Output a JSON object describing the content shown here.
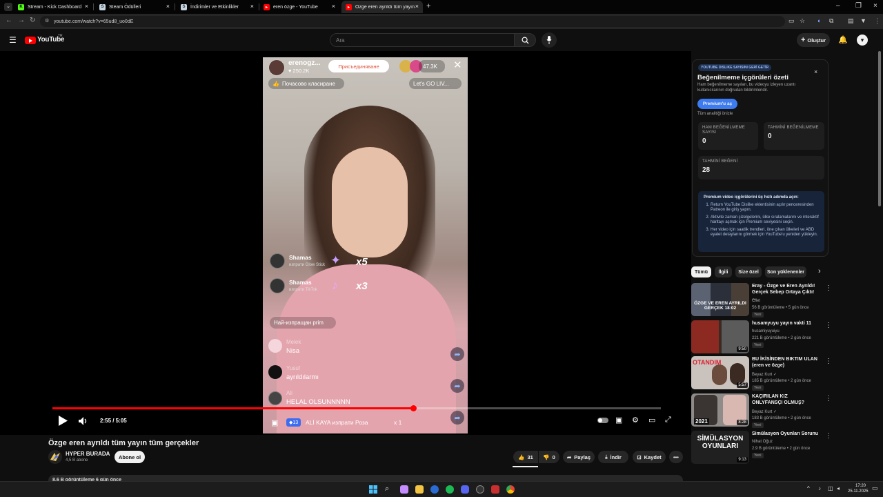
{
  "browser": {
    "tabs": [
      {
        "label": "Stream - Kick Dashboard",
        "icon": "kick-icon",
        "color": "#53fc18"
      },
      {
        "label": "Steam Ödülleri",
        "icon": "steam-icon",
        "color": "#1b2838"
      },
      {
        "label": "İndirimler ve Etkinlikler",
        "icon": "steam-icon",
        "color": "#1b2838"
      },
      {
        "label": "eren özge - YouTube",
        "icon": "youtube-icon",
        "color": "#ff0000"
      },
      {
        "label": "Özge eren ayrıldı tüm yayın tüm",
        "icon": "youtube-icon",
        "color": "#ff0000"
      }
    ],
    "url": "youtube.com/watch?v=65ud8_uo0dE"
  },
  "youtube": {
    "logo_text": "YouTube",
    "region": "TR",
    "search_placeholder": "Ara",
    "create_label": "Oluştur"
  },
  "video_overlay": {
    "streamer": "erenogz...",
    "likes": "250.2K",
    "join_label": "Присъединяване",
    "viewers": "47.3K",
    "hourly_rank": "Почасово класиране",
    "lets_go": "Let's GO LIV...",
    "gifts": [
      {
        "name": "Shamas",
        "desc": "изпрати Glow Stick",
        "count": "x5"
      },
      {
        "name": "Shamas",
        "desc": "изпрати TikTok",
        "count": "x3"
      }
    ],
    "top_sender": "Най-изпращан prim",
    "comments": [
      {
        "user": "Melek",
        "text": "Nisa"
      },
      {
        "user": "Yusuf",
        "text": "ayrıldılarmı"
      },
      {
        "user": "Ali",
        "text": "HELAL OLSUNNNNN"
      }
    ],
    "bottom_gift_count": "13",
    "bottom_gift_text": "ALİ KAYA изпрати Роза",
    "bottom_gift_mult": "x 1"
  },
  "player": {
    "time": "2:55 / 5:05",
    "progress": 0.594
  },
  "video": {
    "title": "Özge eren ayrıldı tüm yayın tüm gerçekler",
    "channel": "HYPER BURADA",
    "subscribers": "4,5 B abone",
    "subscribe_label": "Abone ol",
    "likes": "31",
    "dislikes": "0",
    "share_label": "Paylaş",
    "download_label": "İndir",
    "save_label": "Kaydet",
    "description_stats": "8,6 B görüntüleme  6 gün önce"
  },
  "rdl_panel": {
    "badge": "YOUTUBE DISLIKE SAYISINI GERİ GETİR",
    "title": "Beğenilmeme içgörüleri özeti",
    "description": "Ham beğenilmeme sayıları, bu videoyu izleyen uzantı kullanıcılarının doğrudan bildirimleridir.",
    "premium_button": "Premium'u aç",
    "preview_link": "Tüm analitiği önizle",
    "raw_dislikes_label": "HAM BEĞENİLMEME SAYISI",
    "raw_dislikes": "0",
    "est_dislikes_label": "TAHMİNİ BEĞENİLMEME",
    "est_dislikes": "0",
    "est_likes_label": "TAHMİNİ BEĞENİ",
    "est_likes": "28",
    "steps_title": "Premium video içgörülerini üç hızlı adımda açın:",
    "steps": [
      "Return YouTube Dislike eklentisinin açılır penceresinden Patreon ile giriş yapın.",
      "Aktivite zaman çizelgelerini, ülke sıralamalarını ve interaktif haritayı açmak için Premium seviyesini seçin.",
      "Her video için saatlik trendleri, öne çıkan ülkeleri ve ABD eyalet detaylarını görmek için YouTube'u yeniden yükleyin."
    ]
  },
  "filter_chips": [
    "Tümü",
    "İlgili",
    "Size özel",
    "Son yüklenenler"
  ],
  "recommendations": [
    {
      "title": "Eray - Özge ve Eren Ayrıldı! Gerçek Sebep Ortaya Çıktı! ...",
      "channel": "Cilet",
      "meta": "56 B görüntüleme • 5 gün önce",
      "badge": "Yeni",
      "duration": "",
      "thumb_text": "ÖZGE VE EREN AYRILDI GERÇEK 18:02",
      "thumb_color": "#2a2f3a"
    },
    {
      "title": "husamyuyu yayın vakti 11",
      "channel": "husamiyuyuiyu",
      "meta": "221 B görüntüleme • 2 gün önce",
      "badge": "Yeni",
      "duration": "9:50",
      "thumb_text": "",
      "thumb_color": "#3a2a22"
    },
    {
      "title": "BU İKİSİNDEN BIKTIM ULAN (eren ve özge)",
      "channel": "Beyaz Kurt",
      "meta": "185 B görüntüleme • 2 gün önce",
      "badge": "Yeni",
      "duration": "5:57",
      "thumb_text": "OTANDIM",
      "thumb_color": "#c9c2bd"
    },
    {
      "title": "KAÇIRILAN KIZ ONLYFANSÇI OLMUŞ?",
      "channel": "Beyaz Kurt",
      "meta": "183 B görüntüleme • 2 gün önce",
      "badge": "Yeni",
      "duration": "8:28",
      "thumb_text": "2021",
      "thumb_color": "#8e8b88"
    },
    {
      "title": "Simülasyon Oyunları Sorunu",
      "channel": "Nihat Oğuz",
      "meta": "2,9 B görüntüleme • 2 gün önce",
      "badge": "Yeni",
      "duration": "9:13",
      "thumb_text": "SİMÜLASYON OYUNLARI",
      "thumb_color": "#202020"
    }
  ],
  "taskbar": {
    "time": "17:20",
    "date": "25.11.2025"
  }
}
